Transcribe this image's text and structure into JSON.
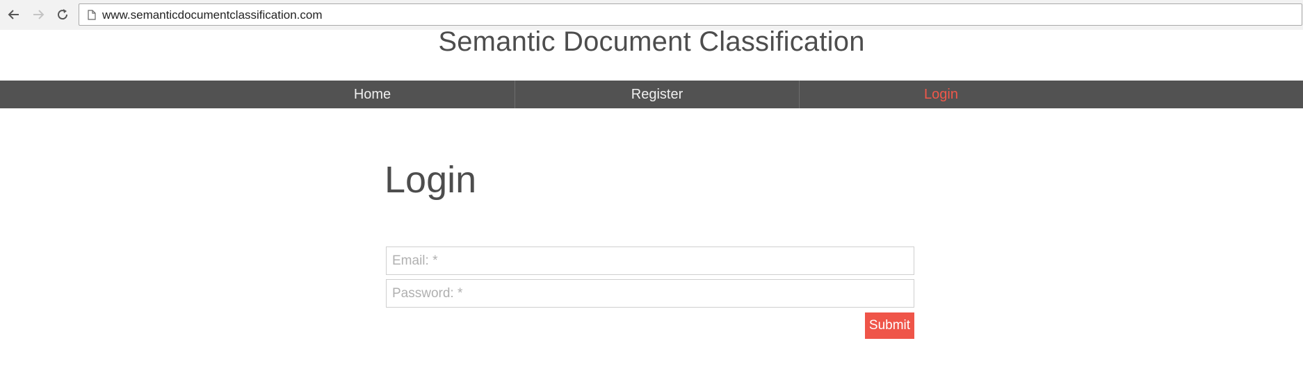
{
  "browser": {
    "back_icon": "arrow-left-icon",
    "forward_icon": "arrow-right-icon",
    "reload_icon": "reload-icon",
    "page_icon": "page-icon",
    "url": "www.semanticdocumentclassification.com"
  },
  "header": {
    "title": "Semantic Document Classification"
  },
  "nav": {
    "items": [
      {
        "label": "Home",
        "active": false
      },
      {
        "label": "Register",
        "active": false
      },
      {
        "label": "Login",
        "active": true
      }
    ],
    "active_color": "#f0584a",
    "background": "#525252"
  },
  "login_form": {
    "heading": "Login",
    "email_placeholder": "Email: *",
    "password_placeholder": "Password: *",
    "submit_label": "Submit",
    "submit_color": "#ef5549"
  }
}
